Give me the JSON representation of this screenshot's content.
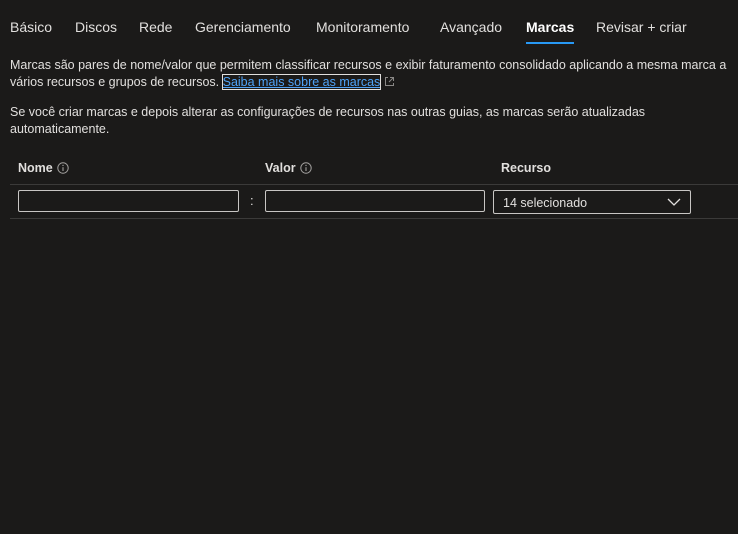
{
  "tabs": [
    {
      "label": "Básico"
    },
    {
      "label": "Discos"
    },
    {
      "label": "Rede"
    },
    {
      "label": "Gerenciamento"
    },
    {
      "label": "Monitoramento"
    },
    {
      "label": "Avançado"
    },
    {
      "label": "Marcas",
      "active": true
    },
    {
      "label": "Revisar + criar"
    }
  ],
  "description": {
    "line1": "Marcas são pares de nome/valor que permitem classificar recursos e exibir faturamento consolidado aplicando a mesma marca a",
    "line2": "vários recursos e grupos de recursos.",
    "link_text": "Saiba mais sobre as marcas",
    "line3": "Se você criar marcas e depois alterar as configurações de recursos nas outras guias, as marcas serão atualizadas",
    "line4": "automaticamente."
  },
  "table": {
    "col_name": "Nome",
    "col_value": "Valor",
    "col_resource": "Recurso",
    "separator": ":",
    "row": {
      "name_value": "",
      "value_value": "",
      "resource_selected": "14 selecionado"
    }
  },
  "colors": {
    "background": "#1b1a19",
    "accent": "#2899f5",
    "link": "#4fa3f7"
  },
  "icons": {
    "info": "info-icon",
    "external_link": "external-link-icon",
    "dropdown": "chevron-down-icon"
  }
}
